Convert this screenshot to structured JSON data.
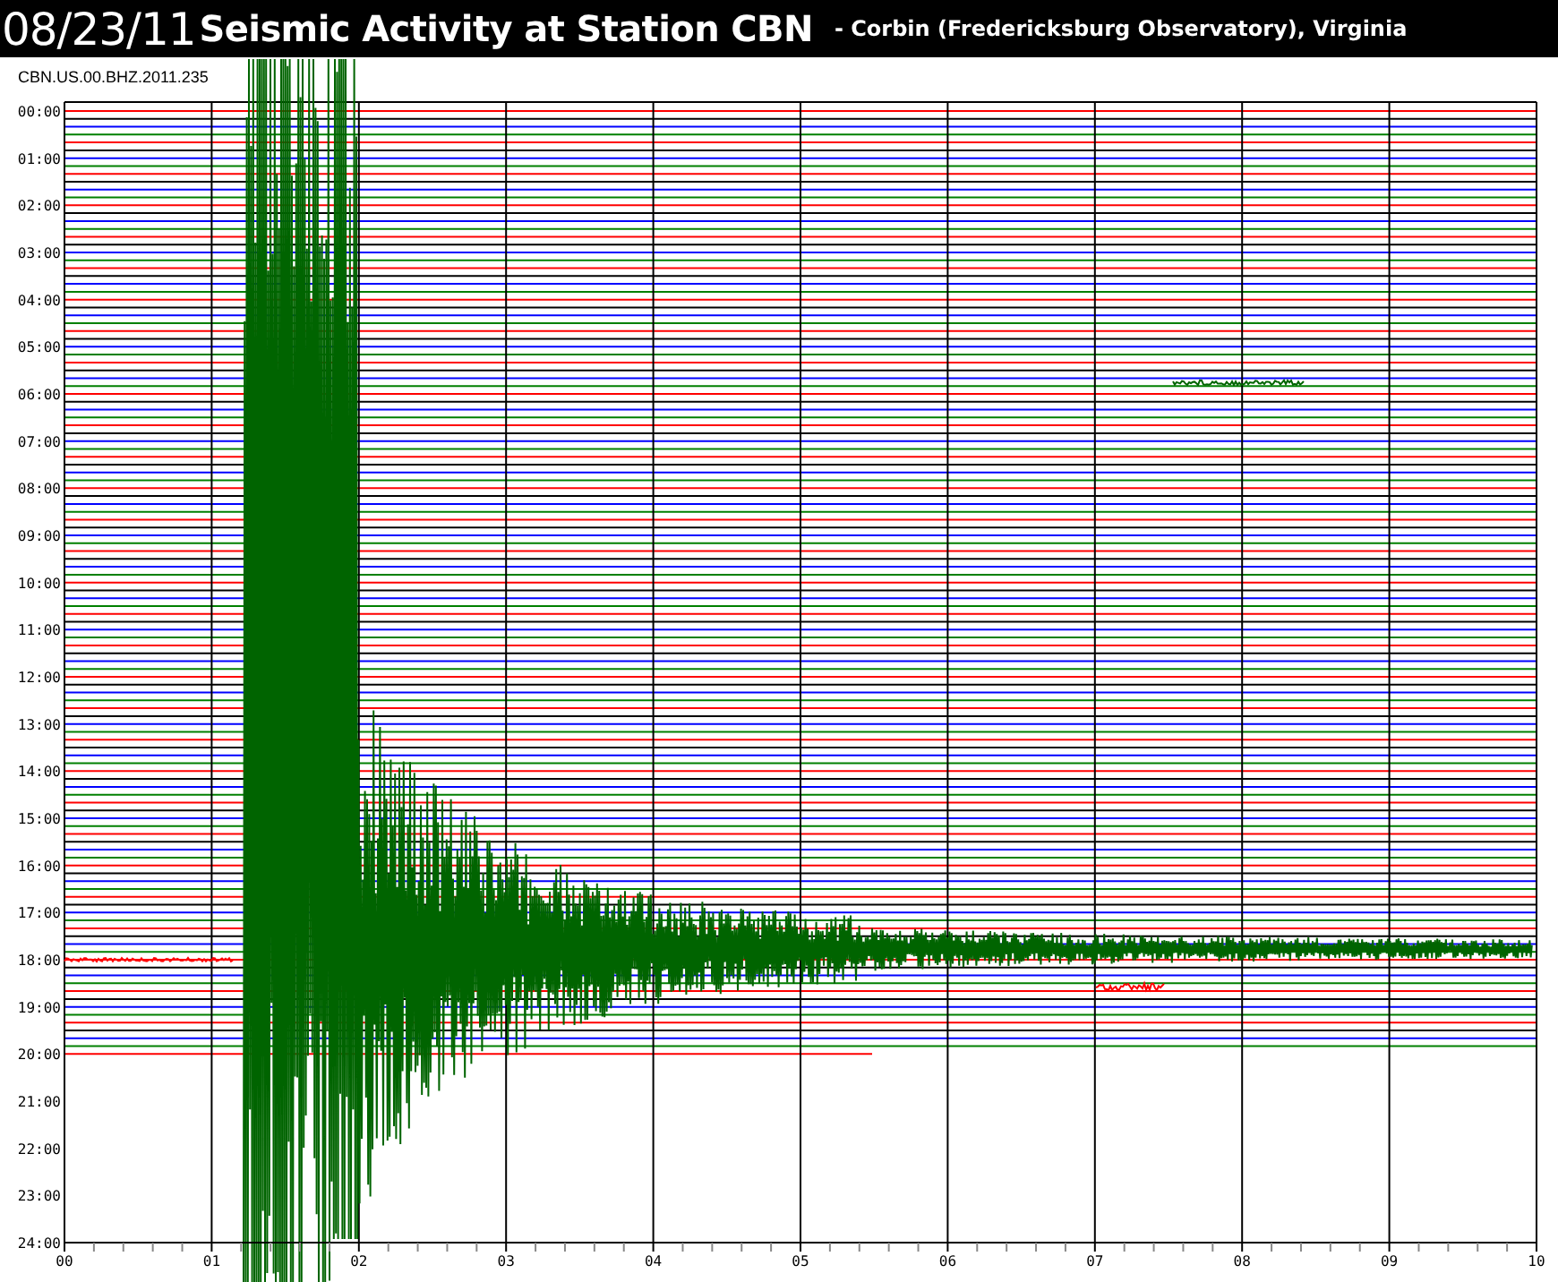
{
  "header": {
    "date": "08/23/11",
    "title": "Seismic Activity at Station CBN",
    "location": "- Corbin (Fredericksburg Observatory), Virginia"
  },
  "channel": "CBN.US.00.BHZ.2011.235",
  "plot": {
    "hour_labels": [
      "00:00",
      "01:00",
      "02:00",
      "03:00",
      "04:00",
      "05:00",
      "06:00",
      "07:00",
      "08:00",
      "09:00",
      "10:00",
      "11:00",
      "12:00",
      "13:00",
      "14:00",
      "15:00",
      "16:00",
      "17:00",
      "18:00",
      "19:00",
      "20:00",
      "21:00",
      "22:00",
      "23:00",
      "24:00"
    ],
    "minute_labels": [
      "00",
      "01",
      "02",
      "03",
      "04",
      "05",
      "06",
      "07",
      "08",
      "09",
      "10"
    ]
  }
}
